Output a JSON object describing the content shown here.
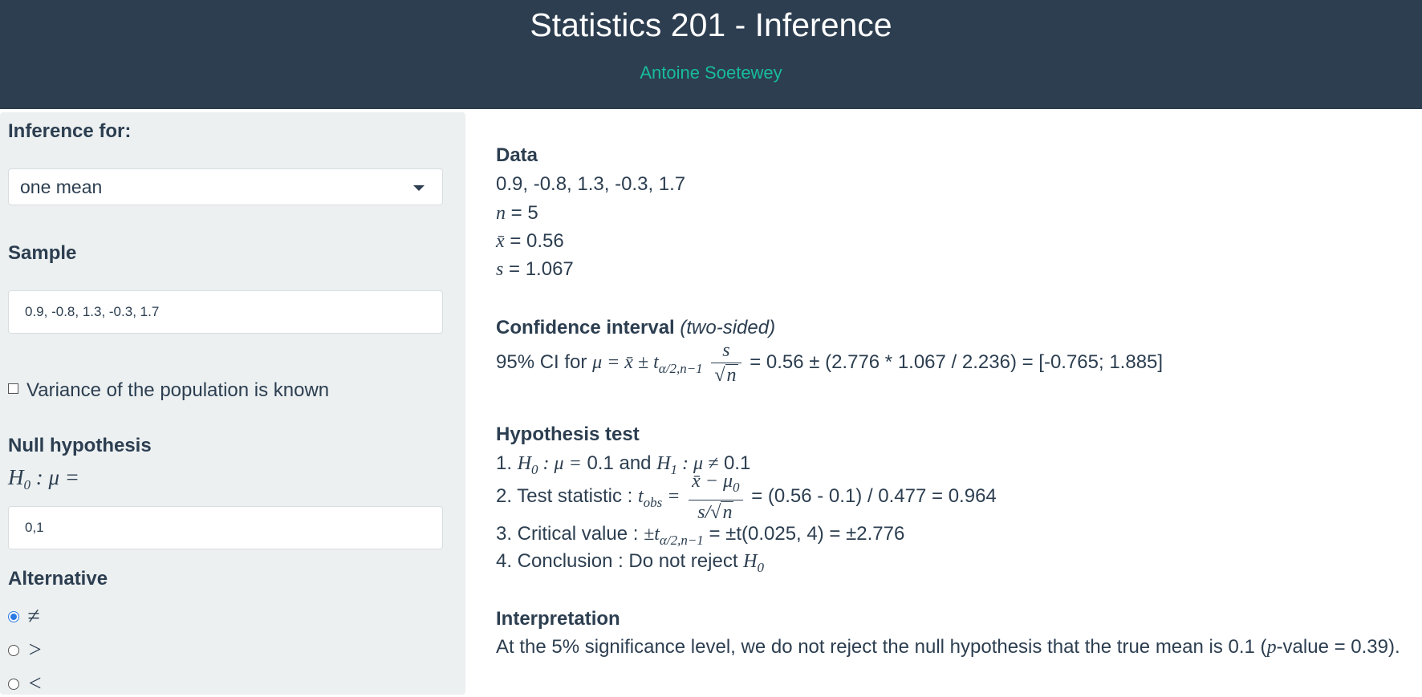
{
  "header": {
    "title": "Statistics 201 - Inference",
    "author": "Antoine Soetewey"
  },
  "sidebar": {
    "inference_label": "Inference for:",
    "inference_selected": "one mean",
    "sample_label": "Sample",
    "sample_value": "0.9, -0.8, 1.3, -0.3, 1.7",
    "variance_known_label": "Variance of the population is known",
    "variance_known_checked": false,
    "null_hypothesis_label": "Null hypothesis",
    "null_hypothesis_value": "0,1",
    "alternative_label": "Alternative",
    "alternative_options": [
      "≠",
      ">",
      "<"
    ],
    "alternative_selected": "≠"
  },
  "main": {
    "data_heading": "Data",
    "data_values": "0.9, -0.8, 1.3, -0.3, 1.7",
    "n_value": "5",
    "xbar_value": "0.56",
    "s_value": "1.067",
    "ci_heading": "Confidence interval",
    "ci_heading_note": "(two-sided)",
    "ci_prefix": "95% CI for",
    "ci_computation": "= 0.56 ± (2.776 * 1.067 / 2.236) = [-0.765; 1.885]",
    "ht_heading": "Hypothesis test",
    "ht_step1_and": "and",
    "ht_mu0": "0.1",
    "ht_step2_label": "2. Test statistic :",
    "ht_step2_result": "= (0.56 - 0.1) / 0.477 = 0.964",
    "ht_step3_label": "3. Critical value :",
    "ht_step3_result": "= ±t(0.025, 4) = ±2.776",
    "ht_step4_label": "4. Conclusion : Do not reject",
    "interp_heading": "Interpretation",
    "interp_text": "At the 5% significance level, we do not reject the null hypothesis that the true mean is 0.1",
    "interp_pvalue": "-value = 0.39)."
  }
}
